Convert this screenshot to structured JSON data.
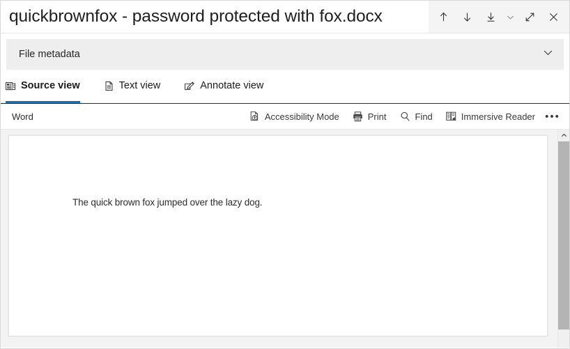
{
  "window": {
    "title": "quickbrownfox - password protected with fox.docx",
    "actions": [
      {
        "name": "previous-match-button",
        "icon": "arrow-up-icon",
        "tooltip": "Previous"
      },
      {
        "name": "next-match-button",
        "icon": "arrow-down-icon",
        "tooltip": "Next"
      },
      {
        "name": "download-button",
        "icon": "download-icon",
        "tooltip": "Download"
      },
      {
        "name": "download-options-button",
        "icon": "chevron-down-icon",
        "tooltip": "More download options"
      },
      {
        "name": "expand-button",
        "icon": "expand-diagonal-icon",
        "tooltip": "Expand"
      },
      {
        "name": "close-button",
        "icon": "close-icon",
        "tooltip": "Close"
      }
    ]
  },
  "metadata_panel": {
    "label": "File metadata",
    "expand_icon": "chevron-down-icon",
    "expanded": false
  },
  "tabs": [
    {
      "label": "Source view",
      "icon": "source-view-icon",
      "active": true
    },
    {
      "label": "Text view",
      "icon": "text-view-icon",
      "active": false
    },
    {
      "label": "Annotate view",
      "icon": "annotate-view-icon",
      "active": false
    }
  ],
  "viewer_toolbar": {
    "app_name": "Word",
    "items": [
      {
        "label": "Accessibility Mode",
        "icon": "accessibility-mode-icon"
      },
      {
        "label": "Print",
        "icon": "printer-icon"
      },
      {
        "label": "Find",
        "icon": "search-icon"
      },
      {
        "label": "Immersive Reader",
        "icon": "immersive-reader-icon"
      }
    ],
    "overflow_label": "•••"
  },
  "document": {
    "body_text": "The quick brown fox jumped over the lazy dog."
  },
  "colors": {
    "accent": "#0078d4",
    "metadata_bg": "#eeeeee",
    "titlebar_actions_bg": "#f4f4f4",
    "doc_area_bg": "#f3f3f3",
    "scrollbar_thumb": "#b4b4b4"
  }
}
